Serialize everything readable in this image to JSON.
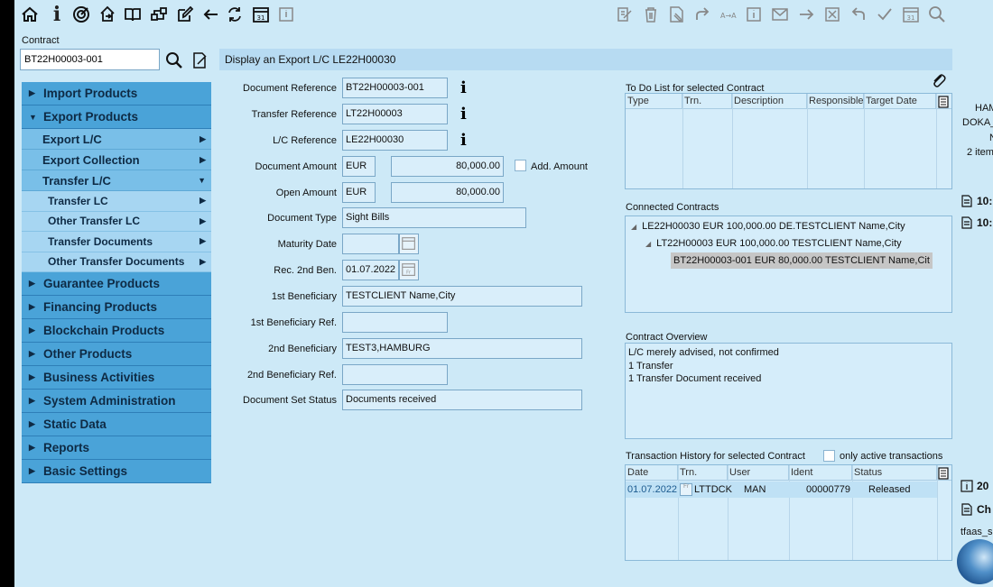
{
  "contract": {
    "label": "Contract",
    "value": "BT22H00003-001"
  },
  "nav": {
    "items": [
      {
        "label": "Import Products",
        "arrow": "▶"
      },
      {
        "label": "Export Products",
        "arrow": "▼"
      }
    ],
    "export_sub": [
      {
        "label": "Export L/C",
        "arrow": "▶"
      },
      {
        "label": "Export Collection",
        "arrow": "▶"
      },
      {
        "label": "Transfer L/C",
        "arrow": "▼"
      }
    ],
    "transfer_sub": [
      {
        "label": "Transfer LC",
        "arrow": "▶"
      },
      {
        "label": "Other Transfer LC",
        "arrow": "▶"
      },
      {
        "label": "Transfer Documents",
        "arrow": "▶"
      },
      {
        "label": "Other Transfer Documents",
        "arrow": "▶"
      }
    ],
    "rest": [
      {
        "label": "Guarantee Products",
        "arrow": "▶"
      },
      {
        "label": "Financing Products",
        "arrow": "▶"
      },
      {
        "label": "Blockchain Products",
        "arrow": "▶"
      },
      {
        "label": "Other Products",
        "arrow": "▶"
      },
      {
        "label": "Business Activities",
        "arrow": "▶"
      },
      {
        "label": "System Administration",
        "arrow": "▶"
      },
      {
        "label": "Static Data",
        "arrow": "▶"
      },
      {
        "label": "Reports",
        "arrow": "▶"
      },
      {
        "label": "Basic Settings",
        "arrow": "▶"
      }
    ]
  },
  "header": {
    "title": "Display an Export L/C LE22H00030"
  },
  "form": {
    "doc_ref_label": "Document Reference",
    "doc_ref": "BT22H00003-001",
    "transfer_ref_label": "Transfer Reference",
    "transfer_ref": "LT22H00003",
    "lc_ref_label": "L/C Reference",
    "lc_ref": "LE22H00030",
    "doc_amount_label": "Document Amount",
    "doc_ccy": "EUR",
    "doc_amount": "80,000.00",
    "add_amount_label": "Add. Amount",
    "open_amount_label": "Open Amount",
    "open_ccy": "EUR",
    "open_amount": "80,000.00",
    "doc_type_label": "Document Type",
    "doc_type": "Sight Bills",
    "maturity_label": "Maturity Date",
    "maturity": "",
    "rec2_label": "Rec. 2nd Ben.",
    "rec2": "01.07.2022",
    "ben1_label": "1st Beneficiary",
    "ben1": "TESTCLIENT Name,City",
    "ben1_ref_label": "1st Beneficiary Ref.",
    "ben1_ref": "",
    "ben2_label": "2nd Beneficiary",
    "ben2": "TEST3,HAMBURG",
    "ben2_ref_label": "2nd Beneficiary Ref.",
    "ben2_ref": "",
    "docset_label": "Document Set Status",
    "docset": "Documents received"
  },
  "todo": {
    "title": "To Do List for selected Contract",
    "columns": [
      "Type",
      "Trn.",
      "Description",
      "Responsible",
      "Target Date"
    ]
  },
  "connected": {
    "title": "Connected Contracts",
    "lines": [
      "LE22H00030 EUR 100,000.00 DE.TESTCLIENT Name,City",
      "LT22H00003 EUR 100,000.00 TESTCLIENT Name,City",
      "BT22H00003-001 EUR 80,000.00 TESTCLIENT Name,Cit"
    ]
  },
  "overview": {
    "title": "Contract Overview",
    "lines": [
      "L/C merely advised, not confirmed",
      "1 Transfer",
      "1 Transfer Document received"
    ]
  },
  "history": {
    "title": "Transaction History for selected Contract",
    "only_active_label": "only active transactions",
    "columns": [
      "Date",
      "Trn.",
      "User",
      "Ident",
      "Status"
    ],
    "rows": [
      {
        "date": "01.07.2022",
        "trn": "LTTDCK",
        "user": "MAN",
        "ident": "00000779",
        "status": "Released"
      }
    ]
  },
  "right": {
    "ham": "HAM",
    "doka": "DOKA_",
    "n": "N",
    "items": "2 item",
    "t1": "10:",
    "t2": "10:",
    "c20": "20",
    "ch": "Ch",
    "tfaas": "tfaas_sa"
  }
}
